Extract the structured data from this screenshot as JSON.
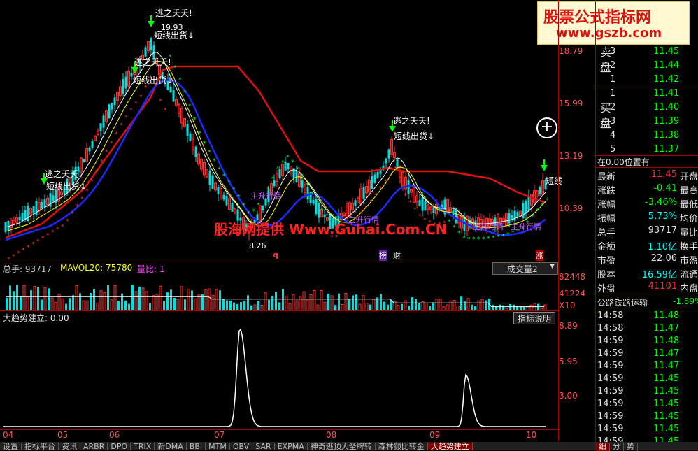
{
  "watermark": {
    "cn_site": "股票公式指标网",
    "url": "www.gszb.com"
  },
  "overlay_text": "股海网提供 Www.Guhai.Com.CN",
  "main_chart": {
    "price_axis": [
      "18.79",
      "15.99",
      "13.19",
      "10.39"
    ],
    "high_label": "19.93",
    "low_label": "8.26",
    "signals": [
      {
        "top": "逃之夭夭!",
        "bottom": "短线出货↓"
      },
      {
        "top": "逃之夭夭!",
        "bottom": "短线出货↓"
      },
      {
        "top": "逃之夭夭!",
        "bottom": "短线出货↓"
      },
      {
        "top": "逃之夭夭!",
        "bottom": "短线出货↓"
      }
    ],
    "short_sell": "短线",
    "bull_labels": [
      "主升行情",
      "主升行情",
      "主升行情",
      "主升行情"
    ],
    "marks": {
      "q": "q",
      "bang": "榜",
      "cai": "财",
      "zhang": "涨"
    }
  },
  "volume_panel": {
    "label": "总手: 93717",
    "ma": "MAVOL20: 75780",
    "ratio": "量比: 1",
    "dropdown": "成交量2",
    "axis": [
      "82448",
      "41224"
    ],
    "unit": "X10"
  },
  "indicator_panel": {
    "label": "大趋势建立: 0.00",
    "button": "指标说明",
    "axis": [
      "8.89",
      "5.95",
      "3.00"
    ]
  },
  "date_axis": [
    "04",
    "05",
    "06",
    "07",
    "08",
    "09",
    "10"
  ],
  "tabs": [
    "设置",
    "指标平台",
    "资讯",
    "ARBR",
    "DPO",
    "TRIX",
    "新DMA",
    "BBI",
    "MTM",
    "OBV",
    "SAR",
    "EXPMA",
    "神奇逃顶大圣牌转",
    "森林频比转金",
    "大趋势建立"
  ],
  "right_panel": {
    "sell_label": "卖盘",
    "buy_label": "买盘",
    "sell_rows": [
      {
        "lvl": "3",
        "price": "11.45"
      },
      {
        "lvl": "2",
        "price": "11.44"
      },
      {
        "lvl": "1",
        "price": "11.42"
      }
    ],
    "buy_rows": [
      {
        "lvl": "1",
        "price": "11.41"
      },
      {
        "lvl": "2",
        "price": "11.40"
      },
      {
        "lvl": "3",
        "price": "11.39"
      },
      {
        "lvl": "4",
        "price": "11.38"
      },
      {
        "lvl": "5",
        "price": "11.37"
      }
    ],
    "position": "在0.00位置有",
    "stats": [
      {
        "k": "最新",
        "v": "11.45",
        "k2": "开盘"
      },
      {
        "k": "涨跌",
        "v": "-0.41",
        "k2": "最高"
      },
      {
        "k": "涨幅",
        "v": "-3.46%",
        "k2": "最低"
      },
      {
        "k": "振幅",
        "v": "5.73%",
        "k2": "均价"
      },
      {
        "k": "总手",
        "v": "93717",
        "k2": "量比"
      },
      {
        "k": "金额",
        "v": "1.10亿",
        "k2": "换手"
      },
      {
        "k": "市盈",
        "v": "22.06",
        "k2": "市盈"
      },
      {
        "k": "股本",
        "v": "16.59亿",
        "k2": "流通"
      },
      {
        "k": "外盘",
        "v": "41101",
        "k2": "内盘"
      }
    ],
    "sector": {
      "name": "公路铁路运输",
      "change": "-1.89%"
    },
    "ticks": [
      {
        "t": "14:58",
        "p": "11.48"
      },
      {
        "t": "14:58",
        "p": "11.47"
      },
      {
        "t": "14:59",
        "p": "11.48"
      },
      {
        "t": "14:59",
        "p": "11.47"
      },
      {
        "t": "14:59",
        "p": "11.47"
      },
      {
        "t": "14:59",
        "p": "11.45"
      },
      {
        "t": "14:59",
        "p": "11.45"
      },
      {
        "t": "14:59",
        "p": "11.45"
      },
      {
        "t": "14:59",
        "p": "11.45"
      },
      {
        "t": "14:59",
        "p": "11.45"
      },
      {
        "t": "14:59",
        "p": "11.45"
      }
    ],
    "bottom_tabs": [
      "细",
      "分",
      "势"
    ]
  }
}
